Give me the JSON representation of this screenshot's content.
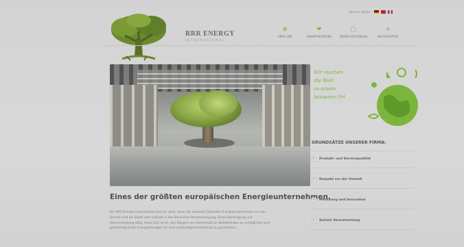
{
  "header": {
    "brand_name": "RRR ENERGY",
    "brand_sub": "INTERNATIONAL",
    "lang_label": "Sprache wählen"
  },
  "nav": [
    {
      "label": "ÜBER UNS",
      "icon": "leaf-icon"
    },
    {
      "label": "VERANTWORTUNG",
      "icon": "sprout-icon"
    },
    {
      "label": "DIENSTLEISTUNGEN",
      "icon": "ring-icon"
    },
    {
      "label": "NACHRICHTEN",
      "icon": "rss-icon"
    }
  ],
  "main": {
    "headline": "Eines der größten europäischen Energieunternehmen.",
    "paragraph_lines": [
      "Bei RRR Energie International sind wir stolz, eines der weltweit führenden Energieunternehmen zu sein.",
      "Derzeit sind wir direkt oder indirekt in den Bereichen Stromerzeugung, Stromübertragung und",
      "Stromverteilung tätig. Unser Ziel ist es, den Bürgern ein Höchstmaß an Wohlbefinden zu ermöglichen und",
      "gleichzeitig beste Energielösungen für eine nachhaltige Entwicklung zu garantieren."
    ]
  },
  "sidebar": {
    "slogan": "Wir machen\ndie Welt\nzu einem\nbesseren Ort",
    "principles_title": "GRUNDSÄTZE UNSERER FIRMA:",
    "principles": [
      "Produkt- und Servicequalität",
      "Respekt vor der Umwelt",
      "Forschung und Innovation",
      "Soziale Verantwortung"
    ]
  },
  "colors": {
    "accent_green": "#79b43a",
    "tree_green": "#5f7f2c",
    "text_dark": "#505050"
  }
}
